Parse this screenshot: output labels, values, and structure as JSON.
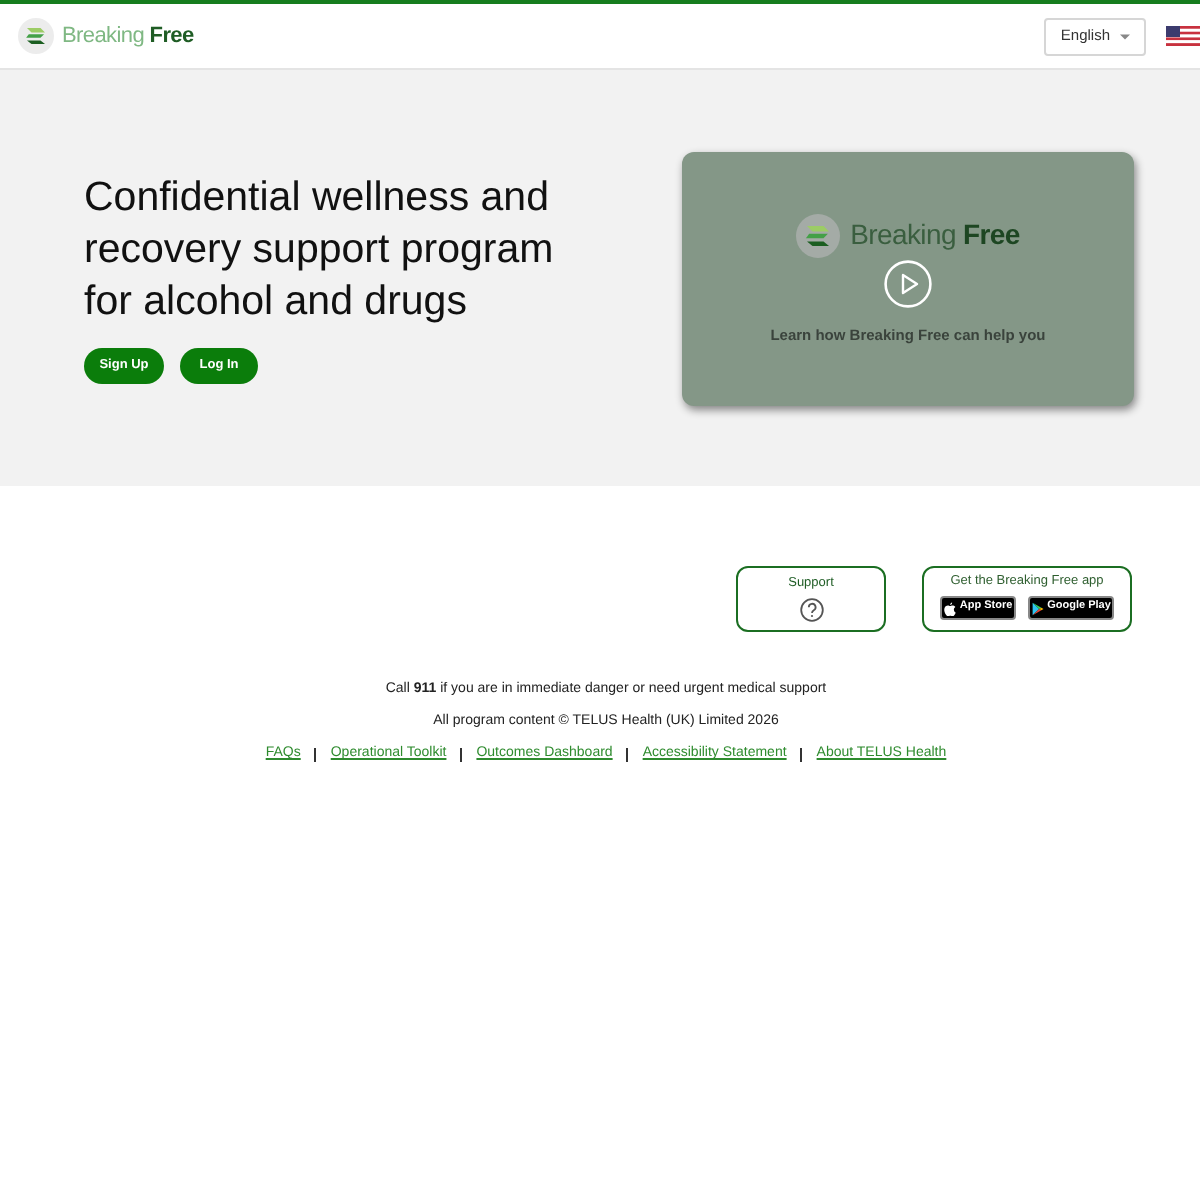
{
  "header": {
    "logo": "Breaking **Free**",
    "language": "English"
  },
  "hero": {
    "heading": "Confidential wellness and recovery support program for alcohol and drugs",
    "buttons": [
      "Sign Up",
      "Log In"
    ],
    "video": {
      "logo": "Breaking **Free**",
      "caption": "Learn how Breaking Free can help you"
    }
  },
  "support": {
    "label": "Support"
  },
  "app": {
    "title": "Get the Breaking Free app",
    "stores": [
      {
        "kind": "apple",
        "label": "App Store"
      },
      {
        "kind": "google",
        "label": "Google Play"
      }
    ]
  },
  "footer": {
    "emergency": "Call **911** if you are in immediate danger or need urgent medical support",
    "copyright": "All program content © TELUS Health (UK) Limited 2026",
    "links": [
      "FAQs",
      "Operational Toolkit",
      "Outcomes Dashboard",
      "Accessibility Statement",
      "About TELUS Health"
    ]
  }
}
